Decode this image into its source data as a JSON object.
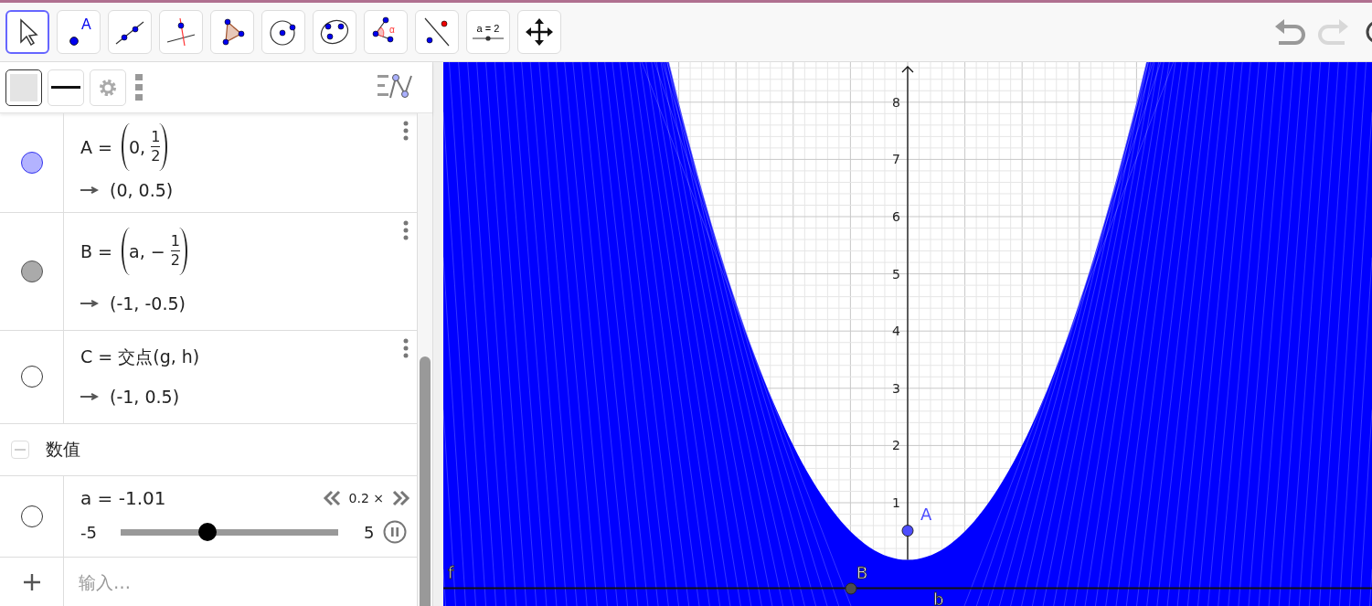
{
  "toolbar": {
    "tools": [
      {
        "kind": "move",
        "selected": true
      },
      {
        "kind": "point",
        "selected": false,
        "label": "A"
      },
      {
        "kind": "line",
        "selected": false
      },
      {
        "kind": "perpendicular",
        "selected": false
      },
      {
        "kind": "polygon",
        "selected": false
      },
      {
        "kind": "circle",
        "selected": false
      },
      {
        "kind": "conic",
        "selected": false
      },
      {
        "kind": "angle",
        "selected": false,
        "label": "α"
      },
      {
        "kind": "reflect",
        "selected": false
      },
      {
        "kind": "slider",
        "selected": false,
        "label": "a = 2"
      },
      {
        "kind": "move-view",
        "selected": false
      }
    ],
    "undo": {
      "disabled": false
    },
    "redo": {
      "disabled": true
    }
  },
  "algebra": {
    "style_bar": [
      {
        "kind": "color"
      },
      {
        "kind": "line-style"
      },
      {
        "kind": "settings"
      },
      {
        "kind": "more"
      }
    ],
    "objects": [
      {
        "visible": true,
        "color": "#b3b3ff",
        "definition": [
          {
            "kind": "text",
            "text": "A = "
          },
          {
            "kind": "paren",
            "items": [
              {
                "kind": "text",
                "text": "0, "
              },
              {
                "kind": "frac",
                "num": "1",
                "den": "2"
              }
            ]
          }
        ],
        "value": "(0, 0.5)"
      },
      {
        "visible": true,
        "color": "#aaaaaa",
        "definition": [
          {
            "kind": "text",
            "text": "B = "
          },
          {
            "kind": "paren",
            "items": [
              {
                "kind": "text",
                "text": "a, − "
              },
              {
                "kind": "frac",
                "num": "1",
                "den": "2"
              }
            ]
          }
        ],
        "value": "(-1, -0.5)"
      },
      {
        "visible": false,
        "definition": [
          {
            "kind": "text",
            "text": "C = 交点(g, h)"
          }
        ],
        "value": "(-1, 0.5)"
      }
    ],
    "group": {
      "title": "数值",
      "expanded": true
    },
    "slider": {
      "visible": false,
      "label": "a = -1.01",
      "speed": "0.2 ×",
      "min": "-5",
      "max": "5",
      "level": 0.4,
      "playing": true
    },
    "input": {
      "placeholder": "输入…"
    }
  },
  "graphics": {
    "yticks": [
      "8",
      "7",
      "6",
      "5",
      "4",
      "3",
      "2",
      "1"
    ],
    "points": [
      {
        "label": "A",
        "color": "#4d4dff"
      },
      {
        "label": "B",
        "color": "#4d4d4d"
      }
    ],
    "curve_labels": [
      "f",
      "b"
    ]
  }
}
